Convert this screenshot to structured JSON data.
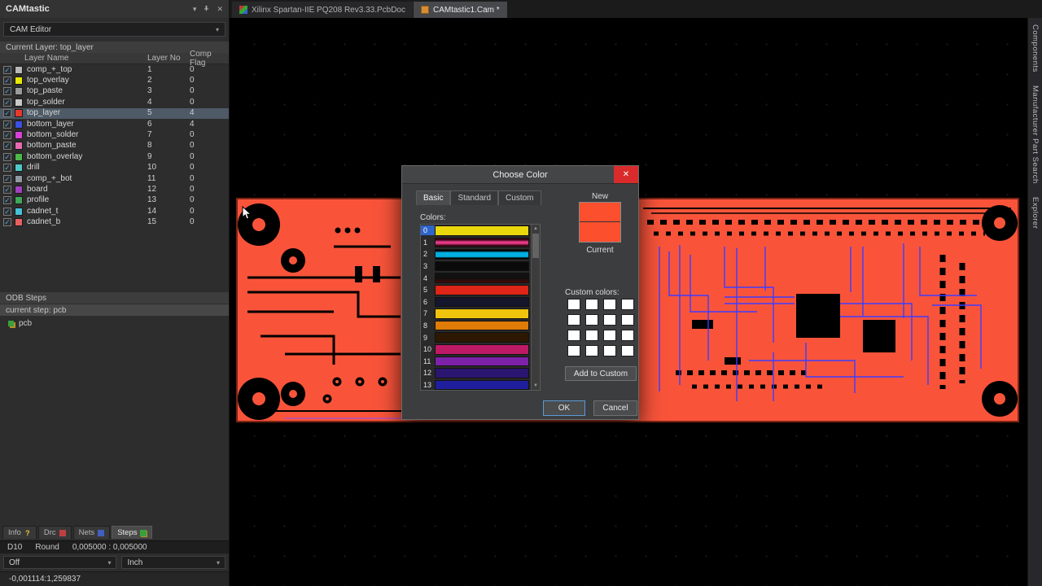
{
  "colors": {
    "board_red": "#f9543a",
    "board_edge": "#7e2415",
    "trace_blue": "#3d3dff",
    "accent_blue": "#2f65ca",
    "close_red": "#d92b2b",
    "swatch_red": "#fb4f2d"
  },
  "left_panel": {
    "title": "CAMtastic",
    "mode_dropdown": "CAM Editor",
    "current_layer": "Current Layer: top_layer",
    "table": {
      "headers": [
        "Layer Name",
        "Layer No",
        "Comp Flag"
      ],
      "rows": [
        {
          "name": "comp_+_top",
          "no": "1",
          "flag": "0",
          "color": "#b8b8b8"
        },
        {
          "name": "top_overlay",
          "no": "2",
          "flag": "0",
          "color": "#e8e800"
        },
        {
          "name": "top_paste",
          "no": "3",
          "flag": "0",
          "color": "#9a9a9a"
        },
        {
          "name": "top_solder",
          "no": "4",
          "flag": "0",
          "color": "#c8c8c8"
        },
        {
          "name": "top_layer",
          "no": "5",
          "flag": "4",
          "color": "#e8392b",
          "selected": true
        },
        {
          "name": "bottom_layer",
          "no": "6",
          "flag": "4",
          "color": "#3c50e0"
        },
        {
          "name": "bottom_solder",
          "no": "7",
          "flag": "0",
          "color": "#d840d8"
        },
        {
          "name": "bottom_paste",
          "no": "8",
          "flag": "0",
          "color": "#e86ab0"
        },
        {
          "name": "bottom_overlay",
          "no": "9",
          "flag": "0",
          "color": "#4ab84a"
        },
        {
          "name": "drill",
          "no": "10",
          "flag": "0",
          "color": "#50c8c8"
        },
        {
          "name": "comp_+_bot",
          "no": "11",
          "flag": "0",
          "color": "#9098a0"
        },
        {
          "name": "board",
          "no": "12",
          "flag": "0",
          "color": "#a040c0"
        },
        {
          "name": "profile",
          "no": "13",
          "flag": "0",
          "color": "#40a858"
        },
        {
          "name": "cadnet_t",
          "no": "14",
          "flag": "0",
          "color": "#48c0d8"
        },
        {
          "name": "cadnet_b",
          "no": "15",
          "flag": "0",
          "color": "#e86060"
        }
      ]
    },
    "odb_steps_title": "ODB Steps",
    "current_step": "current step: pcb",
    "step_name": "pcb",
    "bottom_tabs": [
      {
        "label": "Info",
        "icon": "info-icon"
      },
      {
        "label": "Drc",
        "icon": "drc-icon"
      },
      {
        "label": "Nets",
        "icon": "nets-icon"
      },
      {
        "label": "Steps",
        "icon": "steps-icon",
        "active": true
      }
    ],
    "aperture": "D10",
    "aperture_shape": "Round",
    "aperture_size": "0,005000 : 0,005000",
    "snap_dropdown": "Off",
    "units_dropdown": "Inch",
    "coordinates": "-0,001114:1,259837"
  },
  "doc_tabs": {
    "tabs": [
      {
        "label": "Xilinx Spartan-IIE PQ208 Rev3.33.PcbDoc",
        "active": false
      },
      {
        "label": "CAMtastic1.Cam *",
        "active": true
      }
    ]
  },
  "right_sidebar": {
    "labels": [
      "Components",
      "Manufacturer Part Search",
      "Explorer"
    ]
  },
  "dialog": {
    "title": "Choose Color",
    "tabs": [
      {
        "label": "Basic",
        "active": true
      },
      {
        "label": "Standard"
      },
      {
        "label": "Custom"
      }
    ],
    "colors_label": "Colors:",
    "palette": [
      {
        "index": "0",
        "css": "#ead70c",
        "selected": true
      },
      {
        "index": "1",
        "css": "linear-gradient(180deg,#3a0614 18%,#e23a86 40%,#e23a86 62%,#3a0614 85%)"
      },
      {
        "index": "2",
        "css": "linear-gradient(180deg,#000000 12%,#00aee0 30%,#00aee0 78%,#000000 90%)"
      },
      {
        "index": "3",
        "css": "#0a0a0a"
      },
      {
        "index": "4",
        "css": "linear-gradient(180deg,#111111 55%,#4a0606 100%)"
      },
      {
        "index": "5",
        "css": "#de2517"
      },
      {
        "index": "6",
        "css": "#15152c"
      },
      {
        "index": "7",
        "css": "#f0c40c"
      },
      {
        "index": "8",
        "css": "#df7b06"
      },
      {
        "index": "9",
        "css": "#2c1803"
      },
      {
        "index": "10",
        "css": "#bd1a66"
      },
      {
        "index": "11",
        "css": "#7d22a8"
      },
      {
        "index": "12",
        "css": "#2a1670"
      },
      {
        "index": "13",
        "css": "#1f1f9e"
      }
    ],
    "new_label": "New",
    "current_label": "Current",
    "custom_label": "Custom colors:",
    "custom_grid": {
      "rows": 4,
      "cols": 4,
      "color": "#ffffff"
    },
    "add_button": "Add to Custom",
    "ok_button": "OK",
    "cancel_button": "Cancel"
  }
}
